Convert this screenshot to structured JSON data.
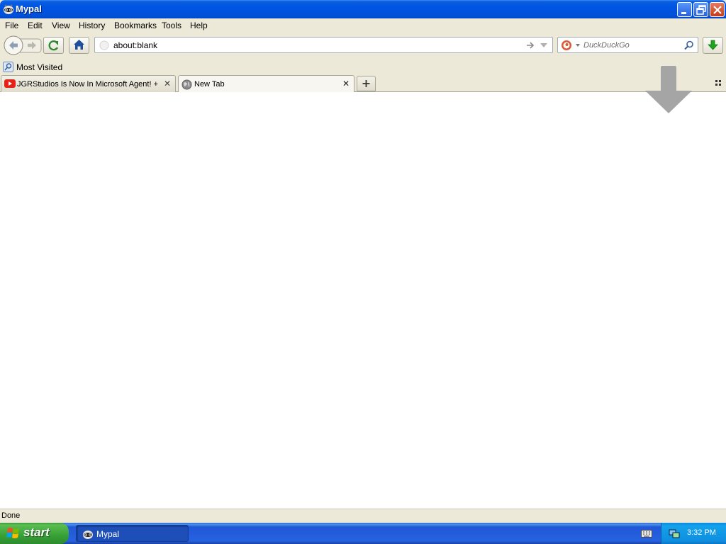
{
  "window": {
    "title": "Mypal"
  },
  "menu": [
    "File",
    "Edit",
    "View",
    "History",
    "Bookmarks",
    "Tools",
    "Help"
  ],
  "navbar": {
    "url": "about:blank",
    "search_placeholder": "DuckDuckGo"
  },
  "bookmarks": {
    "most_visited": "Most Visited"
  },
  "tabs": [
    {
      "label": "JGRStudios Is Now In Microsoft Agent! +...",
      "icon": "youtube-icon",
      "active": false
    },
    {
      "label": "New Tab",
      "icon": "globe-icon",
      "active": true
    }
  ],
  "status": {
    "text": "Done"
  },
  "taskbar": {
    "start_label": "start",
    "task_label": "Mypal",
    "clock": "3:32 PM"
  },
  "colors": {
    "titlebar": "#0054e3",
    "chrome": "#ece9d8",
    "taskbar": "#2663e0",
    "start": "#37a136"
  }
}
